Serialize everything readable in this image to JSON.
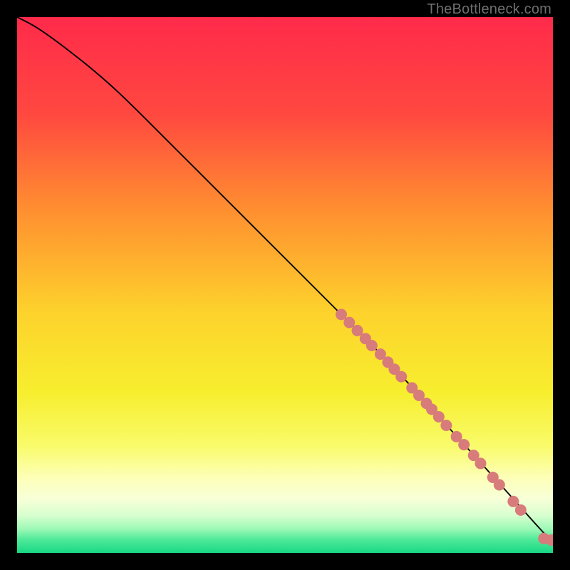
{
  "watermark": "TheBottleneck.com",
  "chart_data": {
    "type": "line",
    "title": "",
    "xlabel": "",
    "ylabel": "",
    "xlim": [
      0,
      100
    ],
    "ylim": [
      0,
      100
    ],
    "grid": false,
    "legend": false,
    "series": [
      {
        "name": "curve",
        "kind": "line",
        "color": "#000000",
        "x": [
          0,
          3,
          6,
          10,
          15,
          20,
          30,
          40,
          50,
          60,
          70,
          80,
          90,
          98,
          100
        ],
        "y": [
          100,
          98.5,
          96.5,
          93.5,
          89.5,
          85,
          75,
          65,
          55,
          45,
          35,
          24,
          13,
          4,
          2
        ]
      },
      {
        "name": "points",
        "kind": "scatter",
        "color": "#d87b7b",
        "r": 8,
        "x": [
          60.5,
          62.0,
          63.5,
          65.0,
          66.2,
          67.8,
          69.2,
          70.4,
          71.7,
          73.7,
          75.0,
          76.4,
          77.4,
          78.7,
          80.1,
          82.0,
          83.4,
          85.2,
          86.5,
          88.8,
          90.0,
          92.6,
          94.0,
          98.3,
          99.7
        ],
        "y": [
          44.5,
          43.0,
          41.5,
          40.0,
          38.7,
          37.1,
          35.6,
          34.3,
          32.9,
          30.8,
          29.4,
          27.9,
          26.8,
          25.4,
          23.8,
          21.7,
          20.2,
          18.2,
          16.7,
          14.1,
          12.7,
          9.6,
          8.0,
          2.7,
          2.4
        ]
      }
    ],
    "gradient_stops": [
      {
        "offset": 0.0,
        "color": "#ff2a4a"
      },
      {
        "offset": 0.18,
        "color": "#ff4840"
      },
      {
        "offset": 0.36,
        "color": "#ff8f30"
      },
      {
        "offset": 0.55,
        "color": "#fdd22c"
      },
      {
        "offset": 0.7,
        "color": "#f7ee2e"
      },
      {
        "offset": 0.8,
        "color": "#f9fb6a"
      },
      {
        "offset": 0.86,
        "color": "#fdffb8"
      },
      {
        "offset": 0.9,
        "color": "#f7ffd8"
      },
      {
        "offset": 0.93,
        "color": "#d7ffcf"
      },
      {
        "offset": 0.955,
        "color": "#9ef9b6"
      },
      {
        "offset": 0.975,
        "color": "#4fe99a"
      },
      {
        "offset": 1.0,
        "color": "#18d884"
      }
    ]
  }
}
